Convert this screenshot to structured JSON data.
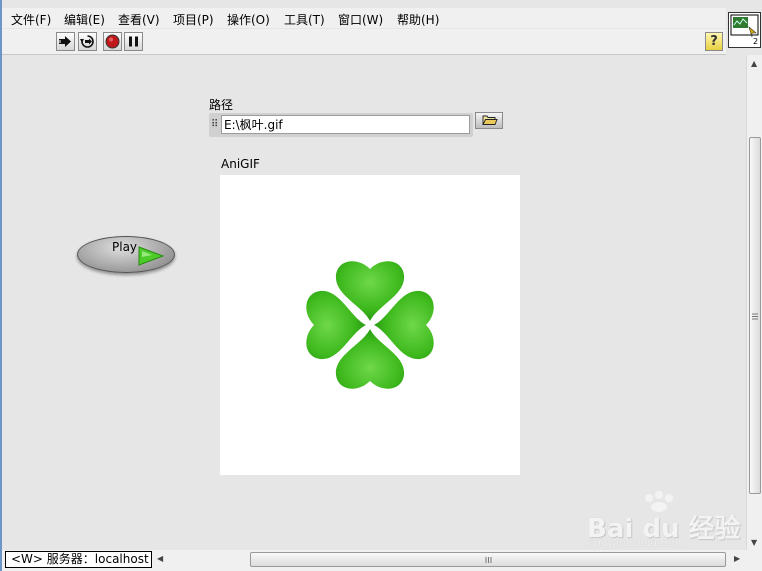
{
  "menu": [
    {
      "label": "文件(F)"
    },
    {
      "label": "编辑(E)"
    },
    {
      "label": "查看(V)"
    },
    {
      "label": "项目(P)"
    },
    {
      "label": "操作(O)"
    },
    {
      "label": "工具(T)"
    },
    {
      "label": "窗口(W)"
    },
    {
      "label": "帮助(H)"
    }
  ],
  "toolbar": {
    "run_icon": "run-arrow-icon",
    "run_continuous_icon": "run-continuously-icon",
    "abort_icon": "abort-icon",
    "pause_icon": "pause-icon",
    "help_label": "?"
  },
  "vi_icon": {
    "badge": "2"
  },
  "path_control": {
    "label": "路径",
    "value": "E:\\枫叶.gif",
    "grip": "⠿"
  },
  "anigif": {
    "label": "AniGIF"
  },
  "play_button": {
    "label": "Play",
    "accent": "#4ccc2a"
  },
  "status": {
    "text": "<W> 服务器：localhost"
  },
  "watermark": {
    "logo": "Bai du 经验",
    "url": "jingyan.baidu.com"
  },
  "colors": {
    "clover": "#3db81c",
    "clover_dark": "#1e8a10"
  }
}
